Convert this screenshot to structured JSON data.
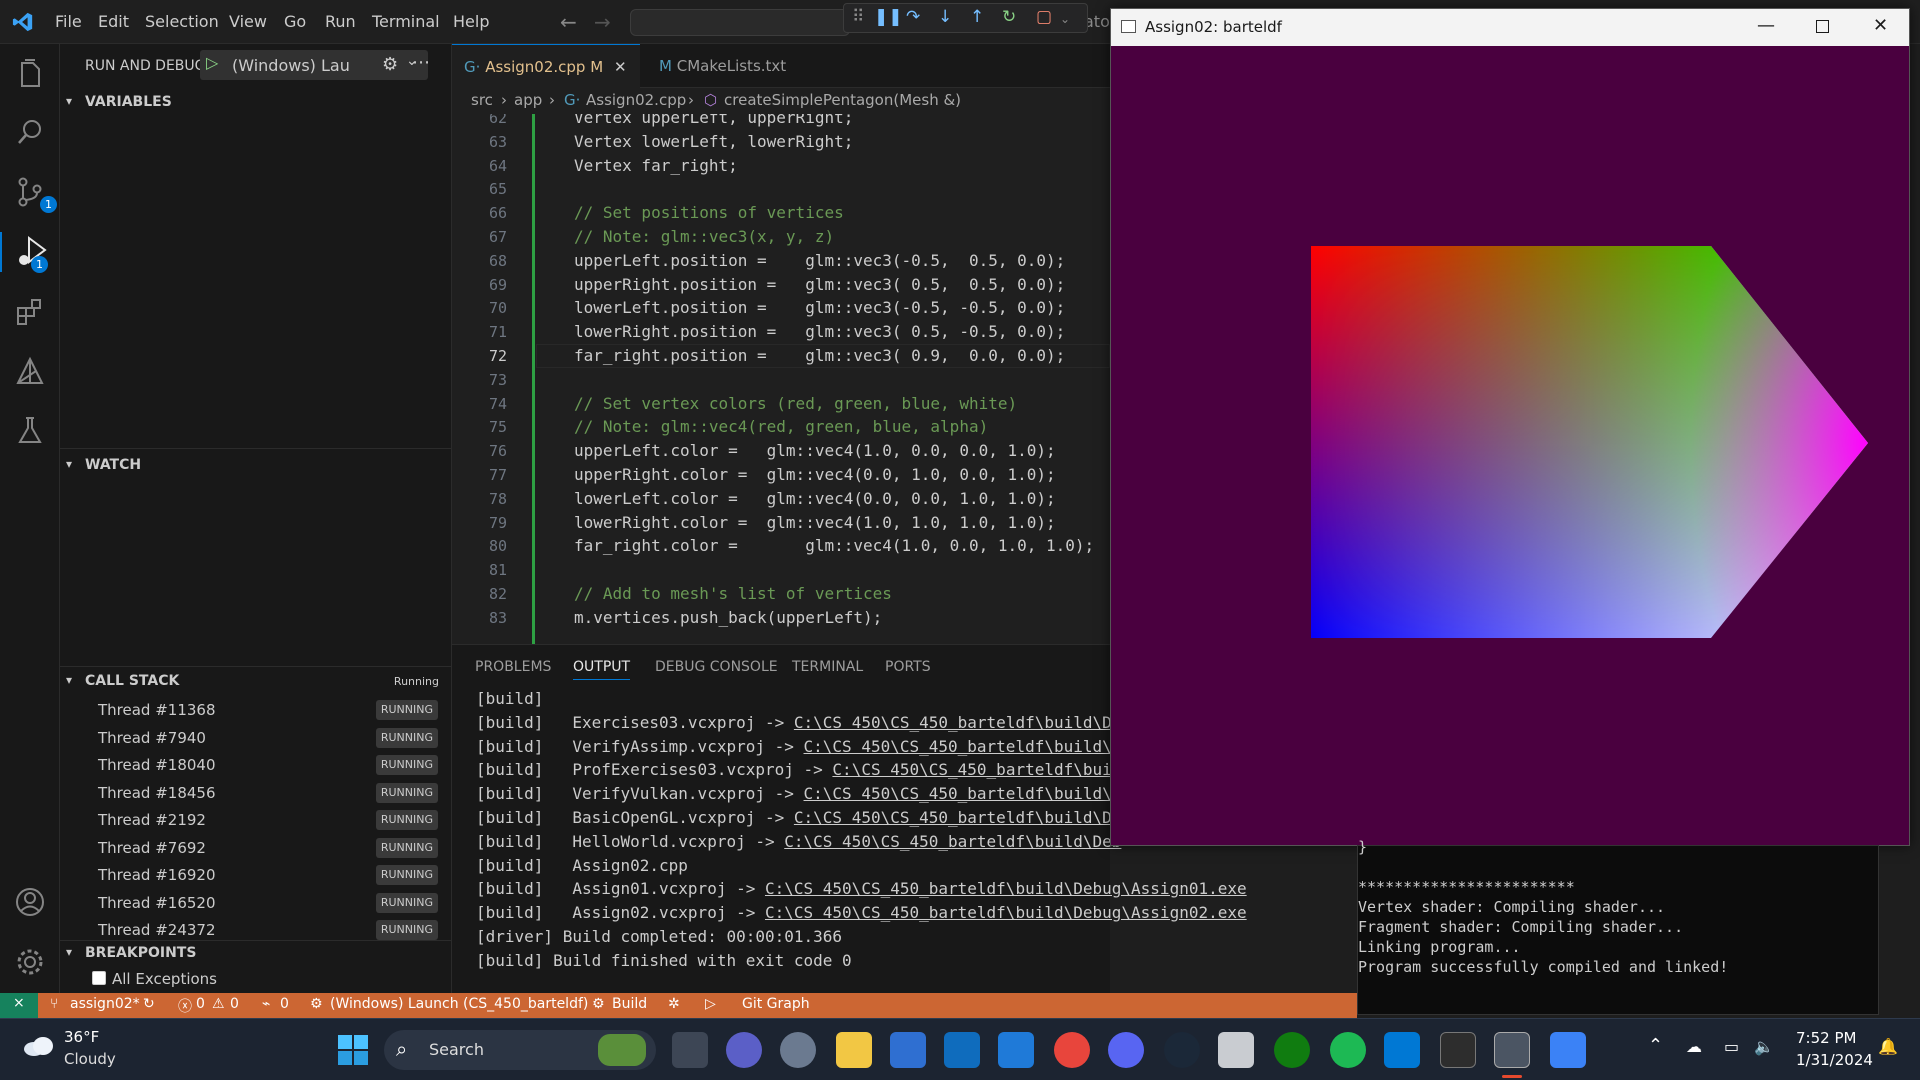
{
  "menu": {
    "items": [
      "File",
      "Edit",
      "Selection",
      "View",
      "Go",
      "Run",
      "Terminal",
      "Help"
    ],
    "truncated_title": "ator"
  },
  "sidebar": {
    "run_debug_label": "RUN AND DEBUG",
    "config_label": "(Windows) Lau",
    "variables_label": "VARIABLES",
    "watch_label": "WATCH",
    "call_stack_label": "CALL STACK",
    "call_stack_status": "Running",
    "threads": [
      {
        "name": "Thread #11368",
        "state": "RUNNING"
      },
      {
        "name": "Thread #7940",
        "state": "RUNNING"
      },
      {
        "name": "Thread #18040",
        "state": "RUNNING"
      },
      {
        "name": "Thread #18456",
        "state": "RUNNING"
      },
      {
        "name": "Thread #2192",
        "state": "RUNNING"
      },
      {
        "name": "Thread #7692",
        "state": "RUNNING"
      },
      {
        "name": "Thread #16920",
        "state": "RUNNING"
      },
      {
        "name": "Thread #16520",
        "state": "RUNNING"
      },
      {
        "name": "Thread #24372",
        "state": "RUNNING"
      }
    ],
    "breakpoints_label": "BREAKPOINTS",
    "all_exceptions_label": "All Exceptions"
  },
  "activity": {
    "scm_badge": "1",
    "debug_badge": "1"
  },
  "editor": {
    "tabs": [
      {
        "label": "Assign02.cpp",
        "modified": "M"
      },
      {
        "label": "CMakeLists.txt"
      }
    ],
    "breadcrumb": [
      "src",
      "app",
      "Assign02.cpp",
      "createSimplePentagon(Mesh &)"
    ],
    "line_numbers": [
      "62",
      "63",
      "64",
      "65",
      "66",
      "67",
      "68",
      "69",
      "70",
      "71",
      "72",
      "73",
      "74",
      "75",
      "76",
      "77",
      "78",
      "79",
      "80",
      "81",
      "82",
      "83"
    ],
    "lines": [
      "Vertex upperLeft, upperRight;",
      "Vertex lowerLeft, lowerRight;",
      "Vertex far_right;",
      "",
      "// Set positions of vertices",
      "// Note: glm::vec3(x, y, z)",
      "upperLeft.position =    glm::vec3(-0.5,  0.5, 0.0);",
      "upperRight.position =   glm::vec3( 0.5,  0.5, 0.0);",
      "lowerLeft.position =    glm::vec3(-0.5, -0.5, 0.0);",
      "lowerRight.position =   glm::vec3( 0.5, -0.5, 0.0);",
      "far_right.position =    glm::vec3( 0.9,  0.0, 0.0);",
      "",
      "// Set vertex colors (red, green, blue, white)",
      "// Note: glm::vec4(red, green, blue, alpha)",
      "upperLeft.color =   glm::vec4(1.0, 0.0, 0.0, 1.0);",
      "upperRight.color =  glm::vec4(0.0, 1.0, 0.0, 1.0);",
      "lowerLeft.color =   glm::vec4(0.0, 0.0, 1.0, 1.0);",
      "lowerRight.color =  glm::vec4(1.0, 1.0, 1.0, 1.0);",
      "far_right.color =       glm::vec4(1.0, 0.0, 1.0, 1.0);",
      "",
      "// Add to mesh's list of vertices",
      "m.vertices.push_back(upperLeft);"
    ]
  },
  "panel": {
    "tabs": [
      "PROBLEMS",
      "OUTPUT",
      "DEBUG CONSOLE",
      "TERMINAL",
      "PORTS"
    ],
    "active_tab": "OUTPUT",
    "output": [
      {
        "pre": "[build]",
        "link": ""
      },
      {
        "pre": "[build]   Exercises03.vcxproj -> ",
        "link": "C:\\CS 450\\CS_450_barteldf\\build\\D"
      },
      {
        "pre": "[build]   VerifyAssimp.vcxproj -> ",
        "link": "C:\\CS 450\\CS_450_barteldf\\build\\"
      },
      {
        "pre": "[build]   ProfExercises03.vcxproj -> ",
        "link": "C:\\CS 450\\CS_450_barteldf\\bui"
      },
      {
        "pre": "[build]   VerifyVulkan.vcxproj -> ",
        "link": "C:\\CS 450\\CS_450_barteldf\\build\\"
      },
      {
        "pre": "[build]   BasicOpenGL.vcxproj -> ",
        "link": "C:\\CS 450\\CS_450_barteldf\\build\\D"
      },
      {
        "pre": "[build]   HelloWorld.vcxproj -> ",
        "link": "C:\\CS 450\\CS_450_barteldf\\build\\Deb"
      },
      {
        "pre": "[build]   Assign02.cpp",
        "link": ""
      },
      {
        "pre": "[build]   Assign01.vcxproj -> ",
        "link": "C:\\CS 450\\CS_450_barteldf\\build\\Debug\\Assign01.exe"
      },
      {
        "pre": "[build]   Assign02.vcxproj -> ",
        "link": "C:\\CS 450\\CS_450_barteldf\\build\\Debug\\Assign02.exe"
      },
      {
        "pre": "[driver] Build completed: 00:00:01.366",
        "link": ""
      },
      {
        "pre": "[build] Build finished with exit code 0",
        "link": ""
      }
    ]
  },
  "app_window": {
    "title": "Assign02: barteldf",
    "background": "#4a003f"
  },
  "terminal": {
    "lines": [
      "}",
      "",
      "************************",
      "Vertex shader: Compiling shader...",
      "Fragment shader: Compiling shader...",
      "Linking program...",
      "Program successfully compiled and linked!"
    ]
  },
  "status": {
    "branch": "assign02*",
    "errors": "0",
    "warnings": "0",
    "ports": "0",
    "launch": "(Windows) Launch (CS_450_barteldf)",
    "build": "Build",
    "git_graph": "Git Graph",
    "color": "#cc6633"
  },
  "taskbar": {
    "weather_temp": "36°F",
    "weather_desc": "Cloudy",
    "search_label": "Search",
    "time": "7:52 PM",
    "date": "1/31/2024"
  }
}
